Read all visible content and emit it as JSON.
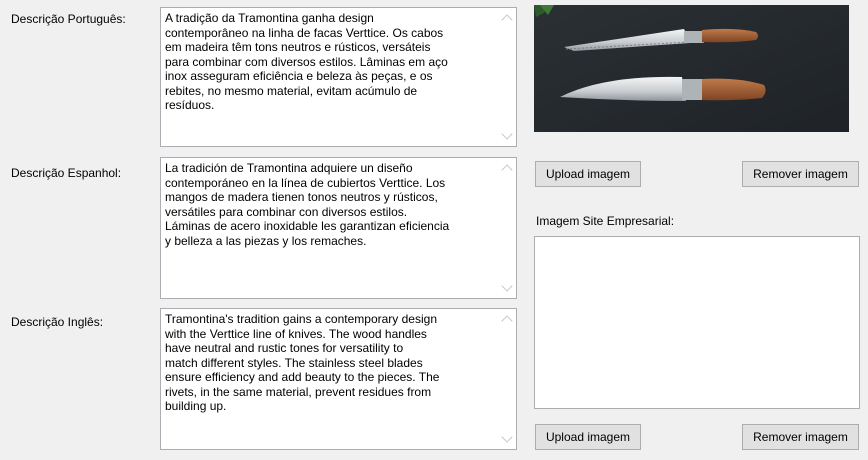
{
  "descriptions": {
    "pt": {
      "label": "Descrição Português:",
      "text": "A tradição da Tramontina ganha design\ncontemporâneo na linha de facas Verttice. Os cabos\nem madeira têm tons neutros e rústicos, versáteis\npara combinar com diversos estilos. Lâminas em aço\ninox asseguram eficiência e beleza às peças, e os\nrebites, no mesmo material, evitam acúmulo de\nresíduos."
    },
    "es": {
      "label": "Descrição Espanhol:",
      "text": "La tradición de Tramontina adquiere un diseño\ncontemporáneo en la línea de cubiertos Verttice. Los\nmangos de madera tienen tonos neutros y rústicos,\nversátiles para combinar con diversos estilos.\nLáminas de acero inoxidable les garantizan eficiencia\ny belleza a las piezas y los remaches."
    },
    "en": {
      "label": "Descrição Inglês:",
      "text": "Tramontina's tradition gains a contemporary design\nwith the Verttice line of knives. The wood handles\nhave neutral and rustic tones for versatility to\nmatch different styles. The stainless steel blades\nensure efficiency and add beauty to the pieces. The\nrivets, in the same material, prevent residues from\nbuilding up."
    }
  },
  "image_main": {
    "upload_label": "Upload imagem",
    "remove_label": "Remover imagem"
  },
  "image_site": {
    "label": "Imagem Site Empresarial:",
    "upload_label": "Upload imagem",
    "remove_label": "Remover imagem"
  }
}
